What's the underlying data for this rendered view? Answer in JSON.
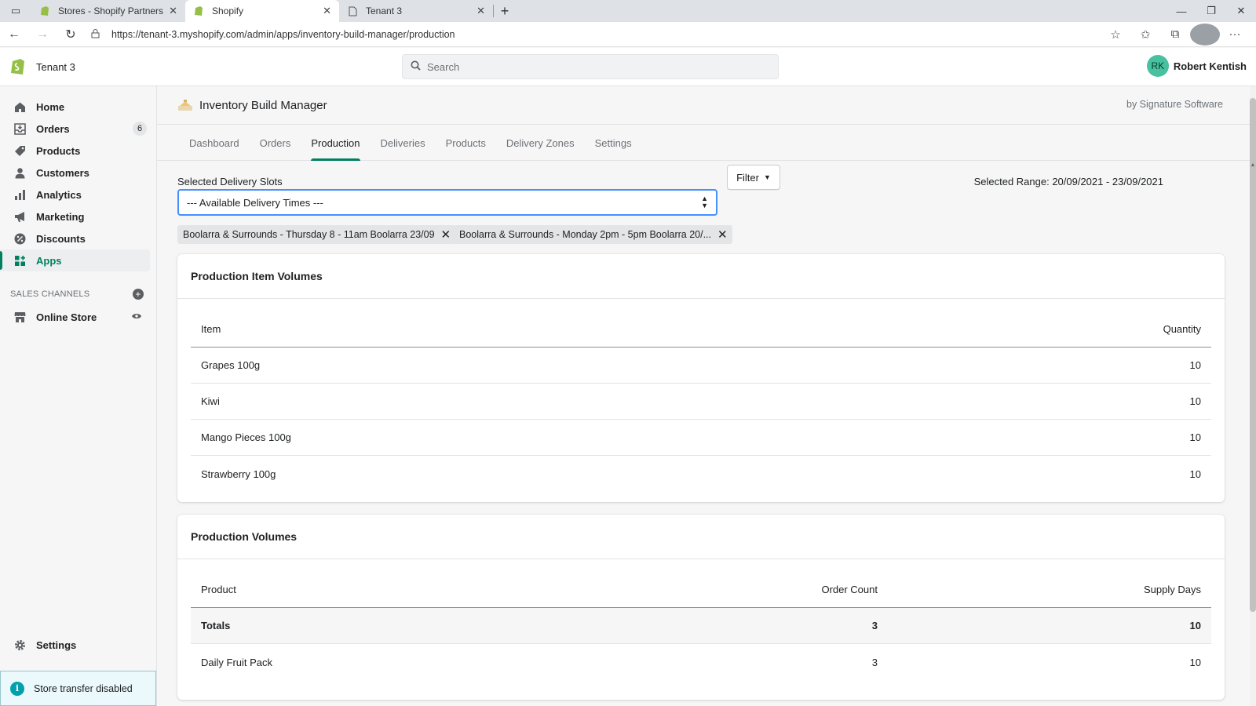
{
  "browser": {
    "tabs": [
      {
        "title": "Stores - Shopify Partners",
        "active": false
      },
      {
        "title": "Shopify",
        "active": true
      },
      {
        "title": "Tenant 3",
        "active": false
      }
    ],
    "url": "https://tenant-3.myshopify.com/admin/apps/inventory-build-manager/production"
  },
  "topbar": {
    "store_name": "Tenant 3",
    "search_placeholder": "Search",
    "user_initials": "RK",
    "user_name": "Robert Kentish"
  },
  "sidebar": {
    "items": [
      {
        "label": "Home",
        "icon": "home-icon"
      },
      {
        "label": "Orders",
        "icon": "orders-icon",
        "badge": "6"
      },
      {
        "label": "Products",
        "icon": "tag-icon"
      },
      {
        "label": "Customers",
        "icon": "person-icon"
      },
      {
        "label": "Analytics",
        "icon": "bar-chart-icon"
      },
      {
        "label": "Marketing",
        "icon": "megaphone-icon"
      },
      {
        "label": "Discounts",
        "icon": "discount-icon"
      },
      {
        "label": "Apps",
        "icon": "apps-icon",
        "active": true
      }
    ],
    "sales_channels_heading": "SALES CHANNELS",
    "online_store": "Online Store",
    "settings": "Settings",
    "transfer_notice": "Store transfer disabled"
  },
  "app": {
    "title": "Inventory Build Manager",
    "by": "by Signature Software",
    "tabs": [
      "Dashboard",
      "Orders",
      "Production",
      "Deliveries",
      "Products",
      "Delivery Zones",
      "Settings"
    ],
    "active_tab": "Production"
  },
  "filters": {
    "slots_label": "Selected Delivery Slots",
    "select_value": "--- Available Delivery Times ---",
    "filter_button": "Filter",
    "selected_range": "Selected Range: 20/09/2021 - 23/09/2021",
    "chips": [
      "Boolarra & Surrounds - Thursday 8 - 11am Boolarra 23/09",
      "Boolarra & Surrounds - Monday 2pm - 5pm Boolarra 20/..."
    ]
  },
  "item_volumes": {
    "title": "Production Item Volumes",
    "headers": {
      "item": "Item",
      "quantity": "Quantity"
    },
    "rows": [
      {
        "item": "Grapes 100g",
        "quantity": "10"
      },
      {
        "item": "Kiwi",
        "quantity": "10"
      },
      {
        "item": "Mango Pieces 100g",
        "quantity": "10"
      },
      {
        "item": "Strawberry 100g",
        "quantity": "10"
      }
    ]
  },
  "production_volumes": {
    "title": "Production Volumes",
    "headers": {
      "product": "Product",
      "order_count": "Order Count",
      "supply_days": "Supply Days"
    },
    "totals": {
      "product": "Totals",
      "order_count": "3",
      "supply_days": "10"
    },
    "rows": [
      {
        "product": "Daily Fruit Pack",
        "order_count": "3",
        "supply_days": "10"
      }
    ]
  },
  "colors": {
    "accent": "#008060",
    "focus_border": "#458fff",
    "avatar": "#47c1a0"
  }
}
